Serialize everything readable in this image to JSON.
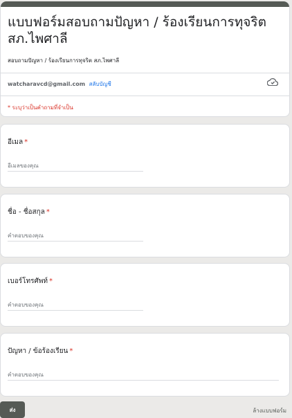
{
  "form": {
    "title": "แบบฟอร์มสอบถามปัญหา / ร้องเรียนการทุจริต สภ.ไพศาลี",
    "description": "สอบถามปัญหา / ร้องเรียนการทุจริต สภ.ไพศาลี",
    "account_email": "watcharavcd@gmail.com",
    "switch_account": "สลับบัญชี",
    "required_note": "* ระบุว่าเป็นคำถามที่จำเป็น",
    "accent_color": "#555a55"
  },
  "questions": [
    {
      "label": "อีเมล",
      "required_mark": "*",
      "placeholder": "อีเมลของคุณ"
    },
    {
      "label": "ชื่อ - ชื่อสกุล",
      "required_mark": "*",
      "placeholder": "คำตอบของคุณ"
    },
    {
      "label": "เบอร์โทรศัพท์",
      "required_mark": "*",
      "placeholder": "คำตอบของคุณ"
    },
    {
      "label": "ปัญหา / ข้อร้องเรียน",
      "required_mark": "*",
      "placeholder": "คำตอบของคุณ"
    }
  ],
  "footer": {
    "submit_label": "ส่ง",
    "clear_label": "ล้างแบบฟอร์ม"
  },
  "icons": {
    "cloud": "cloud-icon"
  }
}
